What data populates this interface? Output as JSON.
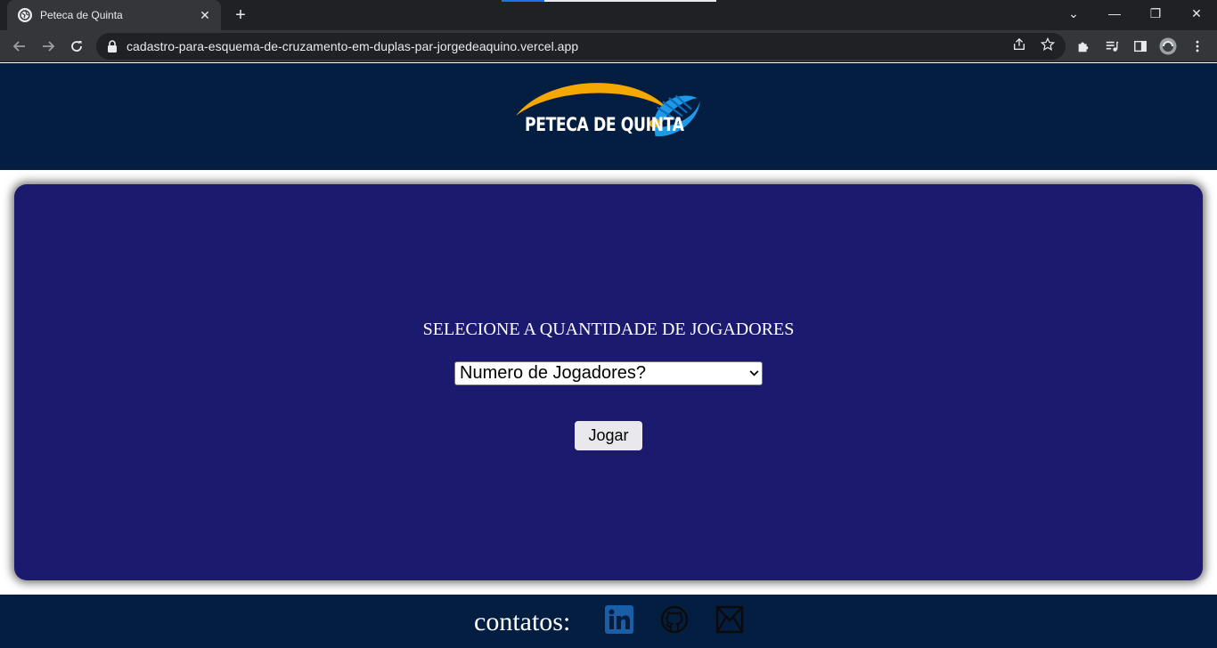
{
  "browser": {
    "tab_title": "Peteca de Quinta",
    "tab_close": "✕",
    "new_tab": "+",
    "url": "cadastro-para-esquema-de-cruzamento-em-duplas-par-jorgedeaquino.vercel.app",
    "window_controls": {
      "dropdown": "⌄",
      "minimize": "—",
      "restore": "❐",
      "close": "✕"
    }
  },
  "header": {
    "logo_text": "PETECA DE QUINTA",
    "logo_colors": {
      "arc": "#f5a800",
      "shuttle": "#1e9be8"
    }
  },
  "main": {
    "prompt": "SELECIONE A QUANTIDADE DE JOGADORES",
    "select": {
      "selected": "Numero de Jogadores?"
    },
    "play_button": "Jogar"
  },
  "footer": {
    "label": "contatos:",
    "links": [
      {
        "icon": "linkedin-icon",
        "color": "#1b5ea8"
      },
      {
        "icon": "github-icon",
        "color": "#0b0b0b"
      },
      {
        "icon": "mail-icon",
        "color": "#0b0b0b"
      }
    ]
  },
  "colors": {
    "header_bg": "#041e42",
    "panel_bg": "#1b1a6e",
    "button_bg": "#e9e9ed"
  }
}
